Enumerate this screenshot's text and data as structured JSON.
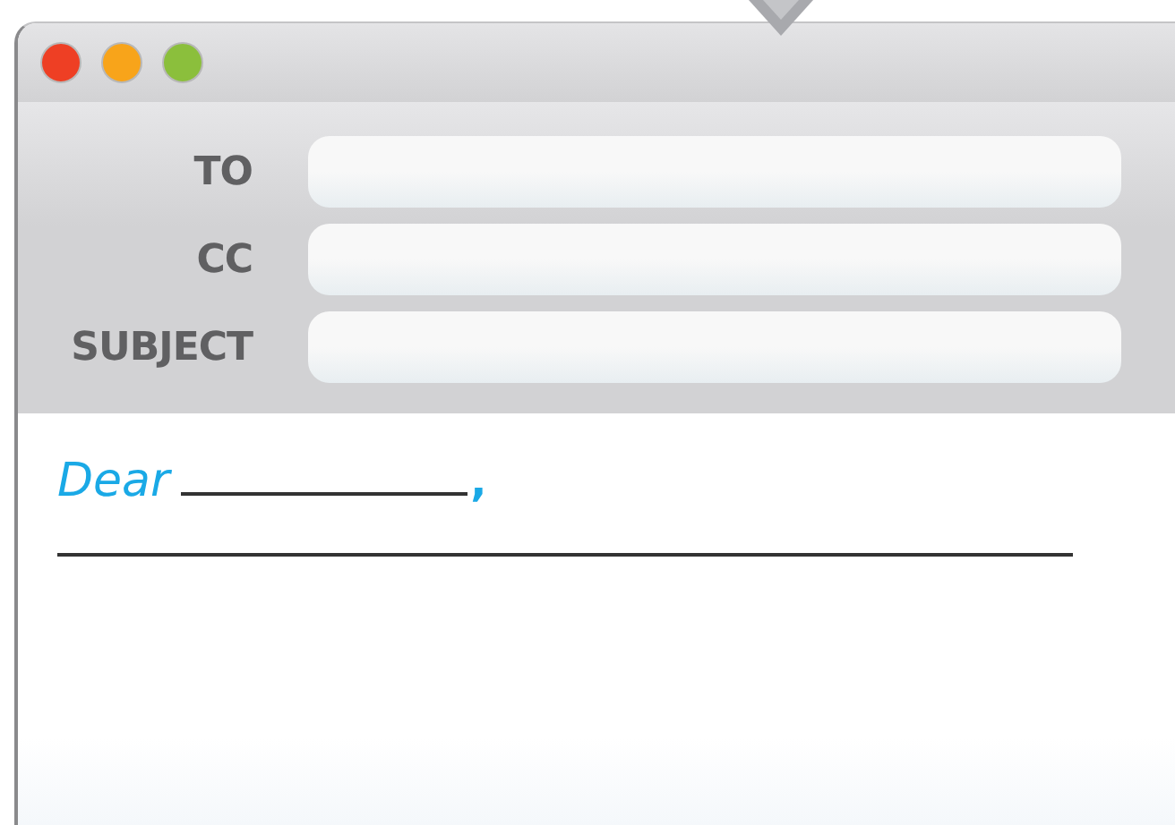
{
  "fields": [
    {
      "label": "TO"
    },
    {
      "label": "CC"
    },
    {
      "label": "SUBJECT"
    }
  ],
  "greeting": {
    "word": "Dear",
    "punctuation": ","
  }
}
